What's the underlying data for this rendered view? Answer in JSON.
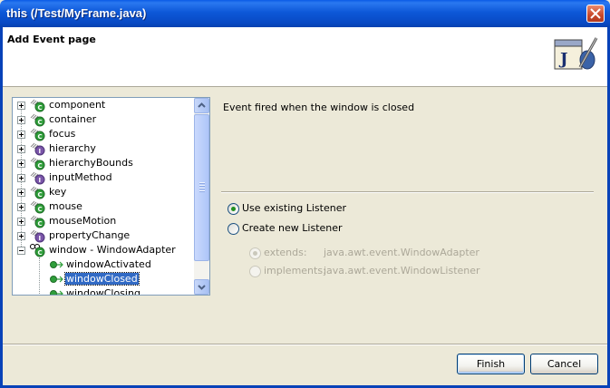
{
  "window": {
    "title": "this (/Test/MyFrame.java)"
  },
  "header": {
    "title": "Add Event page",
    "icon": "java-bean-icon"
  },
  "tree": {
    "items": [
      {
        "label": "component",
        "icon": "class-event-icon",
        "expanded": false
      },
      {
        "label": "container",
        "icon": "class-event-icon",
        "expanded": false
      },
      {
        "label": "focus",
        "icon": "class-event-icon",
        "expanded": false
      },
      {
        "label": "hierarchy",
        "icon": "interface-event-icon",
        "expanded": false
      },
      {
        "label": "hierarchyBounds",
        "icon": "class-event-icon",
        "expanded": false
      },
      {
        "label": "inputMethod",
        "icon": "interface-event-icon",
        "expanded": false
      },
      {
        "label": "key",
        "icon": "class-event-icon",
        "expanded": false
      },
      {
        "label": "mouse",
        "icon": "class-event-icon",
        "expanded": false
      },
      {
        "label": "mouseMotion",
        "icon": "class-event-icon",
        "expanded": false
      },
      {
        "label": "propertyChange",
        "icon": "interface-event-icon",
        "expanded": false
      },
      {
        "label": "window - WindowAdapter",
        "icon": "class-event-icon",
        "expanded": true
      }
    ],
    "children": [
      {
        "label": "windowActivated",
        "selected": false
      },
      {
        "label": "windowClosed",
        "selected": true
      },
      {
        "label": "windowClosing",
        "selected": false
      }
    ]
  },
  "details": {
    "description": "Event fired when the window is closed",
    "use_existing_label": "Use existing Listener",
    "create_new_label": "Create new Listener",
    "extends_label": "extends:",
    "extends_value": "java.awt.event.WindowAdapter",
    "implements_label": "implements:",
    "implements_value": "java.awt.event.WindowListener"
  },
  "buttons": {
    "finish": "Finish",
    "cancel": "Cancel"
  },
  "colors": {
    "titlebar": "#0a5ae6",
    "selection": "#316ac5",
    "dialog_bg": "#ece9d8"
  }
}
